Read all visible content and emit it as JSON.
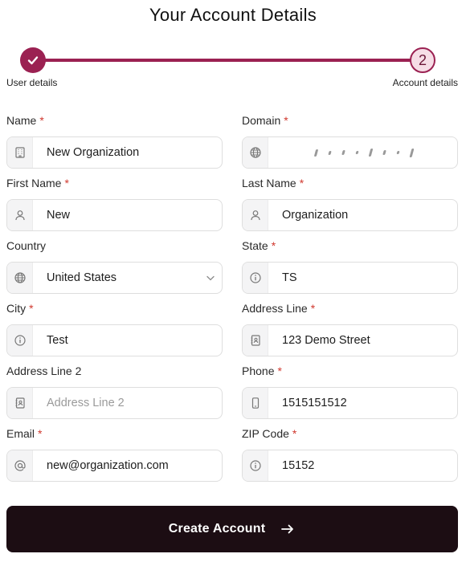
{
  "page": {
    "title": "Your Account Details"
  },
  "stepper": {
    "steps": [
      {
        "label": "User details",
        "state": "completed",
        "icon": "check-icon"
      },
      {
        "label": "Account details",
        "state": "current",
        "number": "2"
      }
    ],
    "accent": "#9b2152"
  },
  "form": {
    "required_mark": "*",
    "fields": {
      "name": {
        "label": "Name",
        "value": "New Organization",
        "icon": "building-icon"
      },
      "domain": {
        "label": "Domain",
        "value": "",
        "icon": "globe-icon"
      },
      "first_name": {
        "label": "First Name",
        "value": "New",
        "icon": "user-icon"
      },
      "last_name": {
        "label": "Last Name",
        "value": "Organization",
        "icon": "user-icon"
      },
      "country": {
        "label": "Country",
        "value": "United States",
        "icon": "globe-icon"
      },
      "state": {
        "label": "State",
        "value": "TS",
        "icon": "info-icon"
      },
      "city": {
        "label": "City",
        "value": "Test",
        "icon": "info-icon"
      },
      "address_line": {
        "label": "Address Line",
        "value": "123 Demo Street",
        "icon": "address-book-icon"
      },
      "address_line2": {
        "label": "Address Line 2",
        "placeholder": "Address Line 2",
        "icon": "address-book-icon"
      },
      "phone": {
        "label": "Phone",
        "value": "1515151512",
        "icon": "phone-icon"
      },
      "email": {
        "label": "Email",
        "value": "new@organization.com",
        "icon": "at-icon"
      },
      "zip": {
        "label": "ZIP Code",
        "value": "15152",
        "icon": "info-icon"
      }
    }
  },
  "submit": {
    "label": "Create Account",
    "icon": "arrow-right-icon",
    "bg": "#1c0d13"
  }
}
